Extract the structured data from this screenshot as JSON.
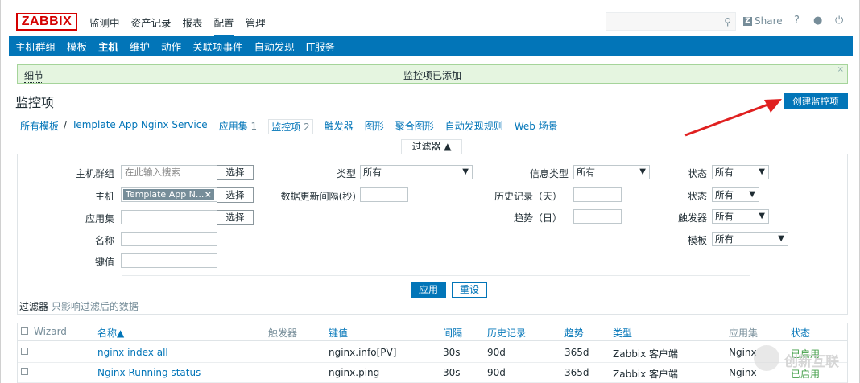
{
  "header": {
    "logo": "ZABBIX",
    "menu": [
      "监测中",
      "资产记录",
      "报表",
      "配置",
      "管理"
    ],
    "active_menu": "配置",
    "search_placeholder": "",
    "share_label": "Share",
    "help": "?"
  },
  "subnav": [
    "主机群组",
    "模板",
    "主机",
    "维护",
    "动作",
    "关联项事件",
    "自动发现",
    "IT服务"
  ],
  "message": {
    "detail_label": "细节",
    "text": "监控项已添加",
    "close": "×"
  },
  "page_title": "监控项",
  "create_button": "创建监控项",
  "breadcrumb": {
    "all_templates": "所有模板",
    "separator": "/",
    "template": "Template App Nginx Service",
    "apps_label": "应用集",
    "apps_count": "1",
    "items_label": "监控项",
    "items_count": "2",
    "triggers": "触发器",
    "graphs": "图形",
    "screens": "聚合图形",
    "discovery": "自动发现规则",
    "web": "Web 场景"
  },
  "filter": {
    "tab_label": "过滤器 ▲",
    "host_group_label": "主机群组",
    "host_group_placeholder": "在此输入搜索",
    "select_btn": "选择",
    "host_label": "主机",
    "host_chip": "Template App N...",
    "app_label": "应用集",
    "name_label": "名称",
    "key_label": "键值",
    "type_label": "类型",
    "type_value": "所有",
    "interval_label": "数据更新间隔(秒)",
    "info_type_label": "信息类型",
    "info_type_value": "所有",
    "history_label": "历史记录（天）",
    "trend_label": "趋势（日）",
    "status_label": "状态",
    "status_value": "所有",
    "state_label": "状态",
    "state_value": "所有",
    "trigger_label": "触发器",
    "trigger_value": "所有",
    "template_label": "模板",
    "template_value": "所有",
    "apply": "应用",
    "reset": "重设",
    "note_bold": "过滤器",
    "note": "只影响过滤后的数据"
  },
  "table": {
    "columns": {
      "wizard": "Wizard",
      "name": "名称▲",
      "triggers": "触发器",
      "key": "键值",
      "interval": "间隔",
      "history": "历史记录",
      "trends": "趋势",
      "type": "类型",
      "apps": "应用集",
      "status": "状态"
    },
    "rows": [
      {
        "name": "nginx index all",
        "key": "nginx.info[PV]",
        "interval": "30s",
        "history": "90d",
        "trends": "365d",
        "type": "Zabbix 客户端",
        "apps": "Nginx",
        "status": "已启用"
      },
      {
        "name": "Nginx Running status",
        "key": "nginx.ping",
        "interval": "30s",
        "history": "90d",
        "trends": "365d",
        "type": "Zabbix 客户端",
        "apps": "Nginx",
        "status": "已启用"
      }
    ]
  },
  "watermark": "创新互联"
}
